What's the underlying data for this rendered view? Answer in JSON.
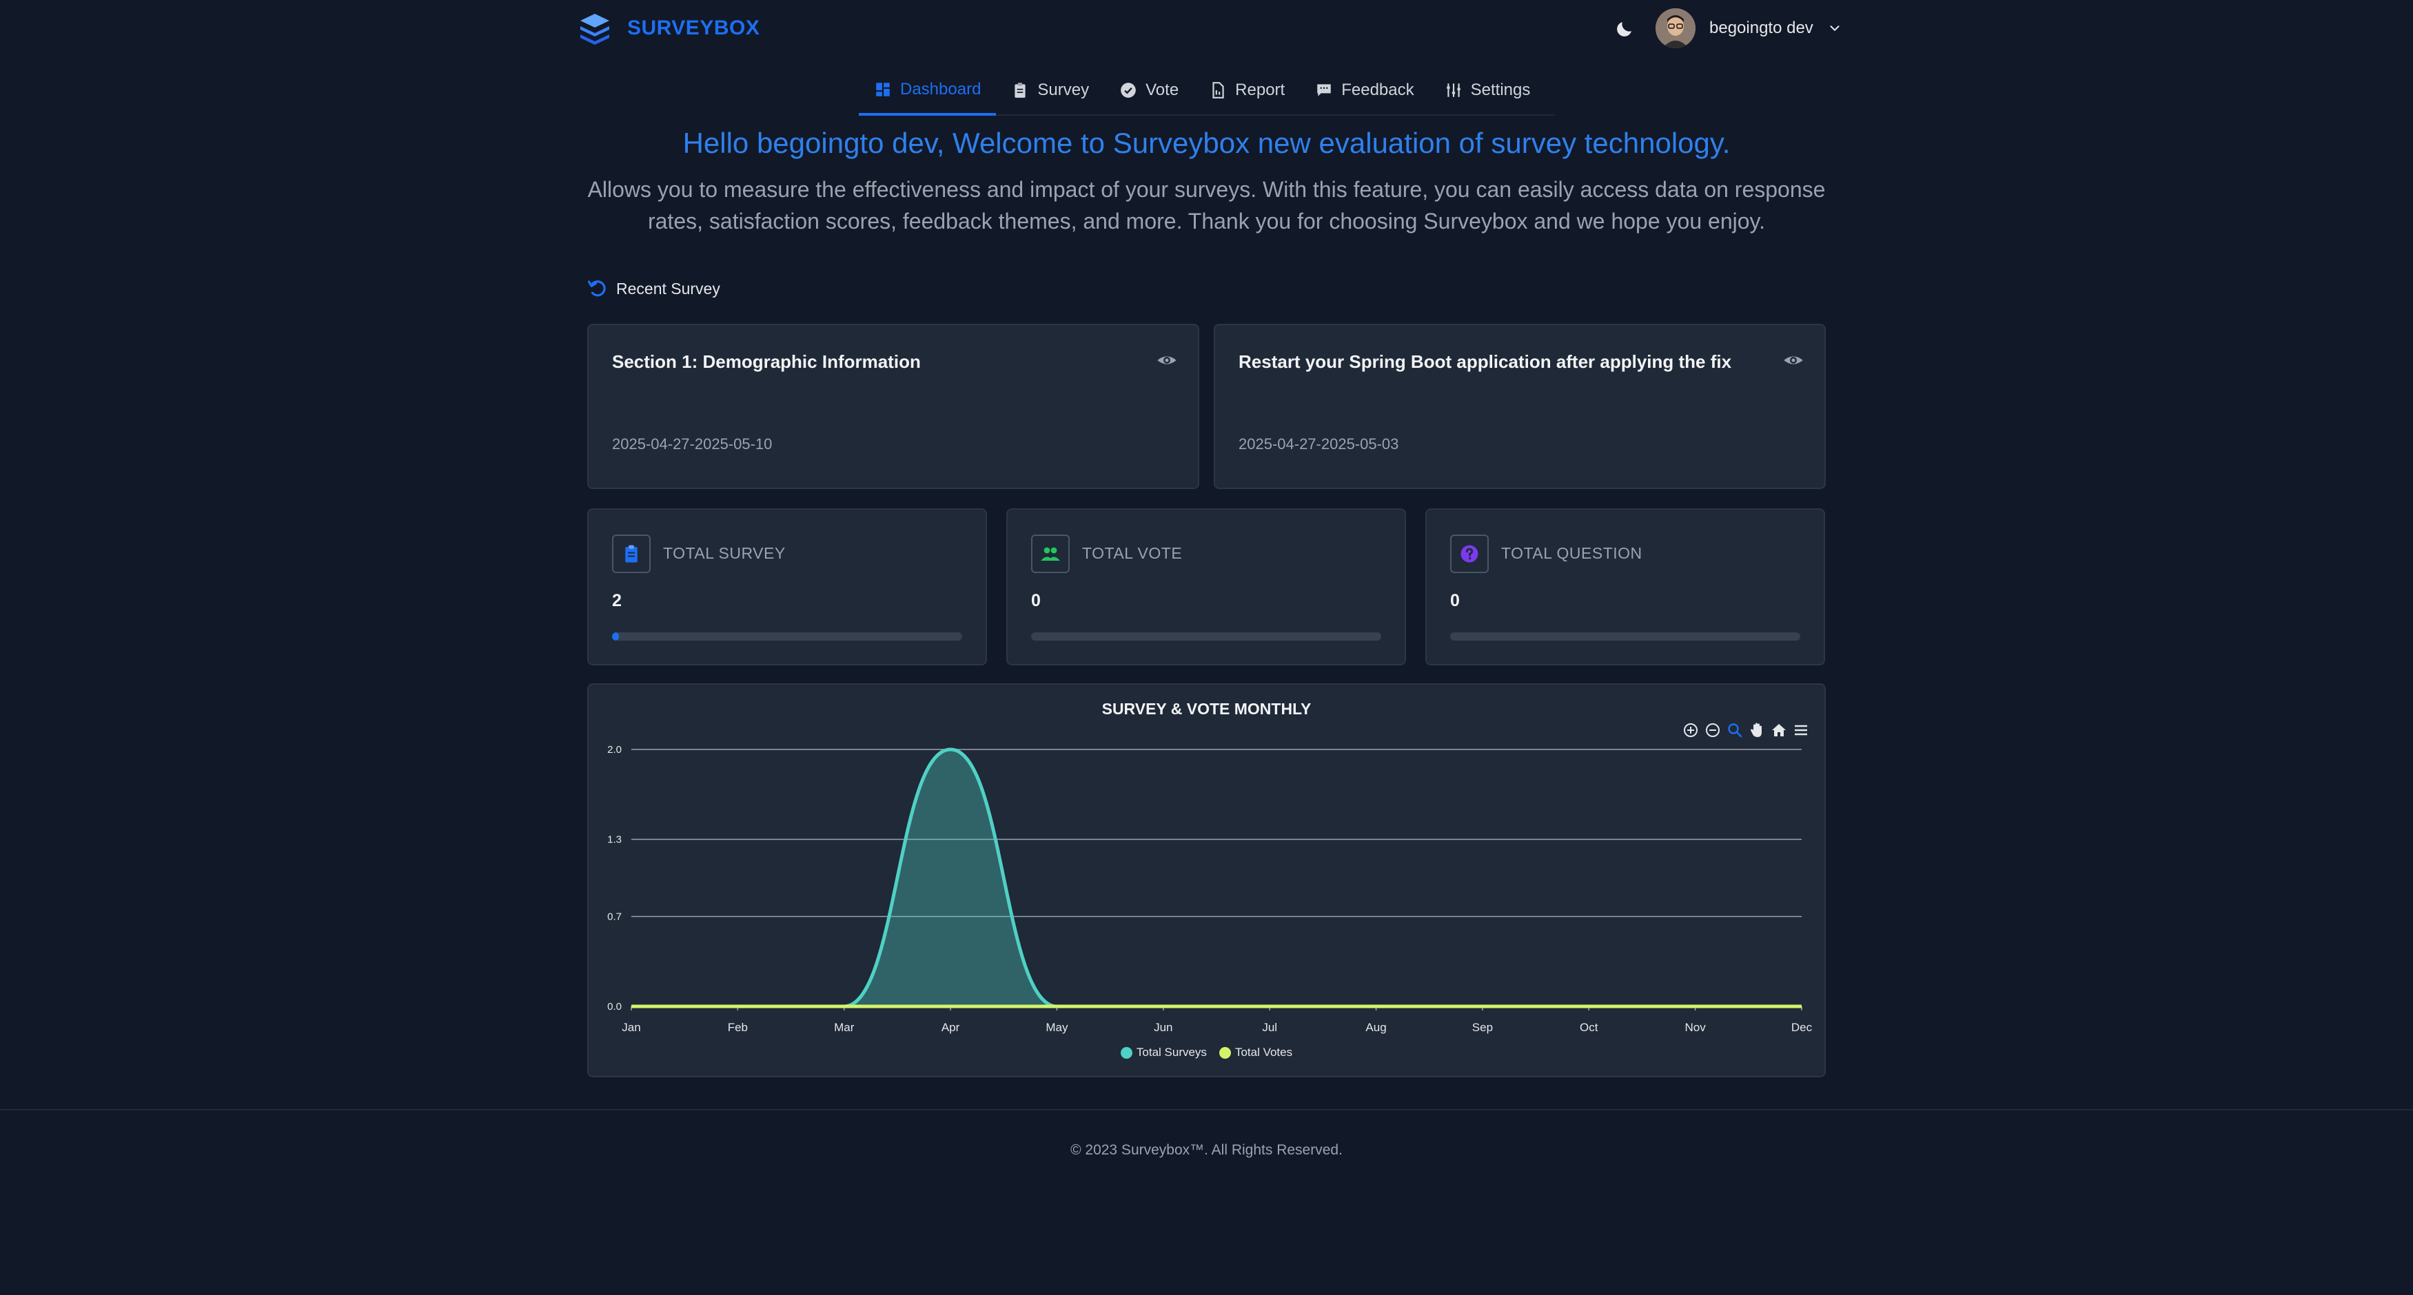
{
  "brand": {
    "name": "SURVEYBOX",
    "color": "#1d6ff2"
  },
  "user": {
    "name": "begoingto dev",
    "avatar_icon": "user-avatar"
  },
  "nav": [
    {
      "label": "Dashboard",
      "icon": "dashboard-icon",
      "active": true
    },
    {
      "label": "Survey",
      "icon": "clipboard-icon",
      "active": false
    },
    {
      "label": "Vote",
      "icon": "check-badge-icon",
      "active": false
    },
    {
      "label": "Report",
      "icon": "document-icon",
      "active": false
    },
    {
      "label": "Feedback",
      "icon": "chat-icon",
      "active": false
    },
    {
      "label": "Settings",
      "icon": "sliders-icon",
      "active": false
    }
  ],
  "hero": {
    "title": "Hello begoingto dev, Welcome to Surveybox new evaluation of survey technology.",
    "subtitle": "Allows you to measure the effectiveness and impact of your surveys. With this feature, you can easily access data on response rates, satisfaction scores, feedback themes, and more. Thank you for choosing Surveybox and we hope you enjoy."
  },
  "recent": {
    "label": "Recent Survey",
    "items": [
      {
        "title": "Section 1: Demographic Information",
        "date": "2025-04-27-2025-05-10"
      },
      {
        "title": "Restart your Spring Boot application after applying the fix",
        "date": "2025-04-27-2025-05-03"
      }
    ]
  },
  "stats": [
    {
      "label": "TOTAL SURVEY",
      "value": "2",
      "icon": "clipboard-icon",
      "color": "#1d6ff2",
      "progress": 0.02
    },
    {
      "label": "TOTAL VOTE",
      "value": "0",
      "icon": "users-icon",
      "color": "#22c55e",
      "progress": 0
    },
    {
      "label": "TOTAL QUESTION",
      "value": "0",
      "icon": "question-icon",
      "color": "#7c3aed",
      "progress": 0
    }
  ],
  "chart_data": {
    "type": "area",
    "title": "SURVEY & VOTE MONTHLY",
    "categories": [
      "Jan",
      "Feb",
      "Mar",
      "Apr",
      "May",
      "Jun",
      "Jul",
      "Aug",
      "Sep",
      "Oct",
      "Nov",
      "Dec"
    ],
    "y_ticks": [
      "0.0",
      "0.7",
      "1.3",
      "2.0"
    ],
    "ylim": [
      0,
      2
    ],
    "series": [
      {
        "name": "Total Surveys",
        "color": "#4fd1c5",
        "values": [
          0,
          0,
          0,
          2,
          0,
          0,
          0,
          0,
          0,
          0,
          0,
          0
        ]
      },
      {
        "name": "Total Votes",
        "color": "#d4f36b",
        "values": [
          0,
          0,
          0,
          0,
          0,
          0,
          0,
          0,
          0,
          0,
          0,
          0
        ]
      }
    ],
    "legend": "bottom",
    "grid": true
  },
  "footer": {
    "text": "© 2023 Surveybox™. All Rights Reserved."
  }
}
